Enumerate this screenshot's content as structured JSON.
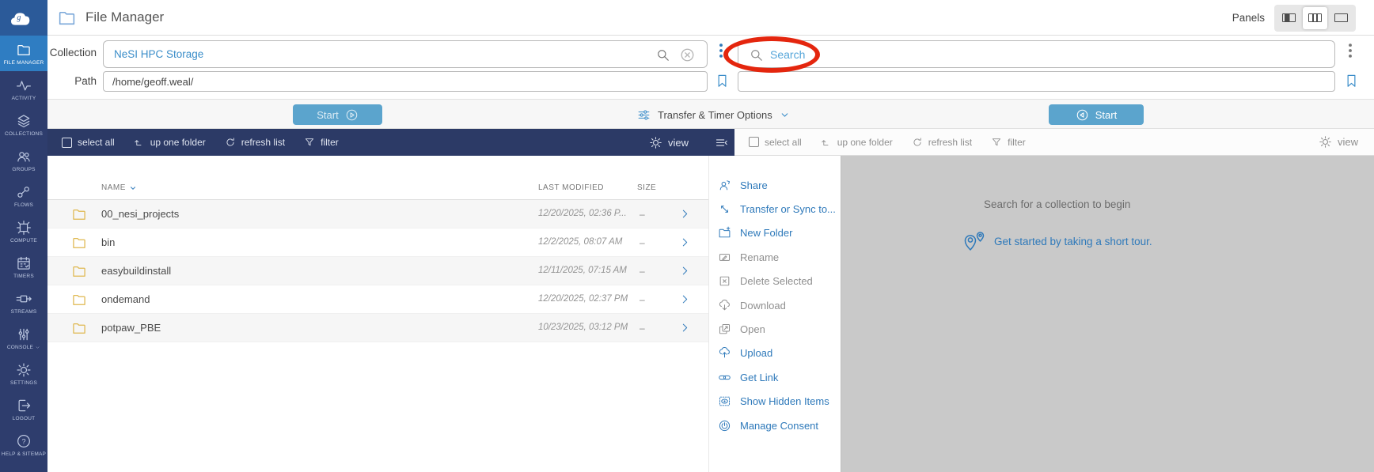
{
  "header": {
    "app_title": "File Manager",
    "panels_label": "Panels",
    "logo_icon": "globus-cloud-logo",
    "panel_buttons": [
      "one-panel",
      "two-panel-selected",
      "three-panel"
    ]
  },
  "sidebar": {
    "items": [
      {
        "label": "FILE MANAGER",
        "icon": "folder-icon",
        "active": true
      },
      {
        "label": "ACTIVITY",
        "icon": "activity-pulse-icon",
        "active": false
      },
      {
        "label": "COLLECTIONS",
        "icon": "layers-icon",
        "active": false
      },
      {
        "label": "GROUPS",
        "icon": "people-icon",
        "active": false
      },
      {
        "label": "FLOWS",
        "icon": "flow-icon",
        "active": false
      },
      {
        "label": "COMPUTE",
        "icon": "chip-icon",
        "active": false
      },
      {
        "label": "TIMERS",
        "icon": "calendar-check-icon",
        "active": false
      },
      {
        "label": "STREAMS",
        "icon": "stream-icon",
        "active": false
      },
      {
        "label": "CONSOLE",
        "icon": "sliders-icon",
        "active": false,
        "has_chevron": true
      },
      {
        "label": "SETTINGS",
        "icon": "gear-icon",
        "active": false
      },
      {
        "label": "LOGOUT",
        "icon": "logout-icon",
        "active": false
      },
      {
        "label": "HELP & SITEMAP",
        "icon": "help-circle-icon",
        "active": false
      }
    ]
  },
  "left_panel": {
    "collection_label": "Collection",
    "collection_value": "NeSI HPC Storage",
    "path_label": "Path",
    "path_value": "/home/geoff.weal/",
    "start_button": "Start",
    "toolbar": {
      "select_all": "select all",
      "up_one_folder": "up one folder",
      "refresh_list": "refresh list",
      "filter": "filter",
      "view": "view"
    },
    "table": {
      "col_name": "NAME",
      "col_modified": "LAST MODIFIED",
      "col_size": "SIZE",
      "rows": [
        {
          "name": "00_nesi_projects",
          "modified": "12/20/2025, 02:36 P...",
          "size": "–"
        },
        {
          "name": "bin",
          "modified": "12/2/2025, 08:07 AM",
          "size": "–"
        },
        {
          "name": "easybuildinstall",
          "modified": "12/11/2025, 07:15 AM",
          "size": "–"
        },
        {
          "name": "ondemand",
          "modified": "12/20/2025, 02:37 PM",
          "size": "–"
        },
        {
          "name": "potpaw_PBE",
          "modified": "10/23/2025, 03:12 PM",
          "size": "–"
        }
      ]
    }
  },
  "transfer_bar": {
    "options_label": "Transfer & Timer Options"
  },
  "action_menu": {
    "items": [
      {
        "label": "Share",
        "icon": "share-person-icon",
        "enabled": true
      },
      {
        "label": "Transfer or Sync to...",
        "icon": "transfer-arrows-icon",
        "enabled": true
      },
      {
        "label": "New Folder",
        "icon": "new-folder-icon",
        "enabled": true
      },
      {
        "label": "Rename",
        "icon": "rename-pencil-icon",
        "enabled": false
      },
      {
        "label": "Delete Selected",
        "icon": "delete-x-icon",
        "enabled": false
      },
      {
        "label": "Download",
        "icon": "cloud-download-icon",
        "enabled": false
      },
      {
        "label": "Open",
        "icon": "open-external-icon",
        "enabled": false
      },
      {
        "label": "Upload",
        "icon": "cloud-upload-icon",
        "enabled": true
      },
      {
        "label": "Get Link",
        "icon": "chain-link-icon",
        "enabled": true
      },
      {
        "label": "Show Hidden Items",
        "icon": "eye-icon",
        "enabled": true
      },
      {
        "label": "Manage Consent",
        "icon": "consent-power-icon",
        "enabled": true
      }
    ]
  },
  "right_panel": {
    "search_placeholder": "Search",
    "path_value": "",
    "start_button": "Start",
    "toolbar": {
      "select_all": "select all",
      "up_one_folder": "up one folder",
      "refresh_list": "refresh list",
      "filter": "filter",
      "view": "view"
    },
    "empty_message": "Search for a collection to begin",
    "tour_link": "Get started by taking a short tour."
  },
  "annotation": {
    "type": "red-circle-highlight",
    "target": "right-panel-search-box"
  },
  "colors": {
    "accent_blue": "#2e79ba",
    "link_blue": "#3a8dc9",
    "sidebar_navy": "#2e3d6d",
    "toolbar_navy": "#2c3a66",
    "active_item_blue": "#2f7dc2",
    "start_button_blue": "#5ba4cd",
    "annotation_red": "#e4260e",
    "folder_yellow": "#dfb84f",
    "right_panel_gray": "#c9c9c9",
    "logo_blue": "#2b5a99"
  }
}
